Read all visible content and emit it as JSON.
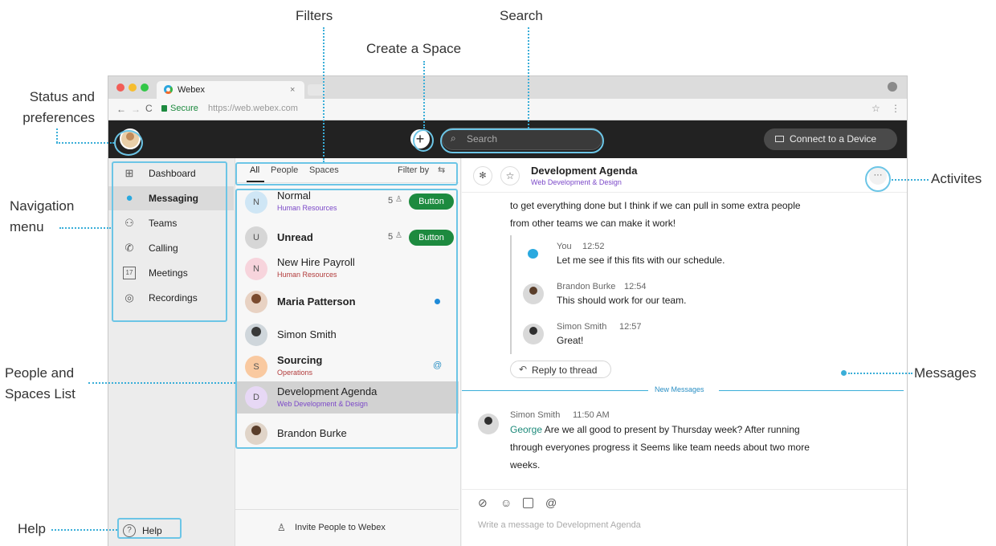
{
  "callouts": {
    "filters": "Filters",
    "search": "Search",
    "create_space": "Create a Space",
    "status_line1": "Status and",
    "status_line2": "preferences",
    "nav_line1": "Navigation",
    "nav_line2": "menu",
    "people_line1": "People and",
    "people_line2": "Spaces List",
    "help": "Help",
    "activities": "Activites",
    "messages": "Messages"
  },
  "browser": {
    "tab_title": "Webex",
    "tab_close": "×",
    "secure_label": "Secure",
    "url": "https://web.webex.com"
  },
  "topbar": {
    "search_placeholder": "Search",
    "connect_label": "Connect to a Device"
  },
  "nav": {
    "items": [
      {
        "label": "Dashboard",
        "icon": "grid-icon"
      },
      {
        "label": "Messaging",
        "icon": "chat-bubble-icon"
      },
      {
        "label": "Teams",
        "icon": "teams-icon"
      },
      {
        "label": "Calling",
        "icon": "phone-icon"
      },
      {
        "label": "Meetings",
        "icon": "calendar-icon",
        "icon_text": "17"
      },
      {
        "label": "Recordings",
        "icon": "record-icon"
      }
    ],
    "help_label": "Help"
  },
  "filters": {
    "tabs": [
      "All",
      "People",
      "Spaces"
    ],
    "filter_by": "Filter by"
  },
  "spaces": [
    {
      "initial": "N",
      "title": "Normal",
      "sub": "Human Resources",
      "count": "5",
      "button": "Button",
      "bold": false
    },
    {
      "initial": "U",
      "title": "Unread",
      "sub": "",
      "count": "5",
      "button": "Button",
      "bold": true
    },
    {
      "initial": "N",
      "title": "New Hire Payroll",
      "sub": "Human Resources",
      "bold": false
    },
    {
      "initial": "",
      "title": "Maria Patterson",
      "sub": "",
      "bold": true,
      "indicator": "unread-dot"
    },
    {
      "initial": "",
      "title": "Simon Smith",
      "sub": "",
      "bold": false
    },
    {
      "initial": "S",
      "title": "Sourcing",
      "sub": "Operations",
      "bold": true,
      "indicator": "@"
    },
    {
      "initial": "D",
      "title": "Development Agenda",
      "sub": "Web Development & Design",
      "bold": false,
      "selected": true
    },
    {
      "initial": "",
      "title": "Brandon Burke",
      "sub": "",
      "bold": false
    }
  ],
  "invite_label": "Invite People to Webex",
  "conversation": {
    "title": "Development Agenda",
    "subtitle": "Web Development & Design",
    "more": "···",
    "intro_line1": "to get everything done but I think if we can pull in some extra people",
    "intro_line2": "from other teams we can make it work!",
    "thread": [
      {
        "name": "You",
        "time": "12:52",
        "text": "Let me see if this fits with our schedule."
      },
      {
        "name": "Brandon Burke",
        "time": "12:54",
        "text": "This should work for our team."
      },
      {
        "name": "Simon Smith",
        "time": "12:57",
        "text": "Great!"
      }
    ],
    "reply_label": "Reply to thread",
    "new_messages_label": "New Messages",
    "latest": {
      "name": "Simon Smith",
      "time": "11:50 AM",
      "mention": "George",
      "line1": " Are we all good to present by Thursday week? After running",
      "line2": "through everyones progress it  Seems like team needs about two more",
      "line3": "weeks."
    },
    "composer_placeholder": "Write a message to Development Agenda",
    "composer_icons": [
      "attach-icon",
      "emoji-icon",
      "gif-icon",
      "mention-icon"
    ]
  },
  "colors": {
    "accent": "#3aaed8",
    "green": "#1d8a3f",
    "purple": "#7b48c8",
    "red": "#b23b3b",
    "topbar": "#222222"
  }
}
